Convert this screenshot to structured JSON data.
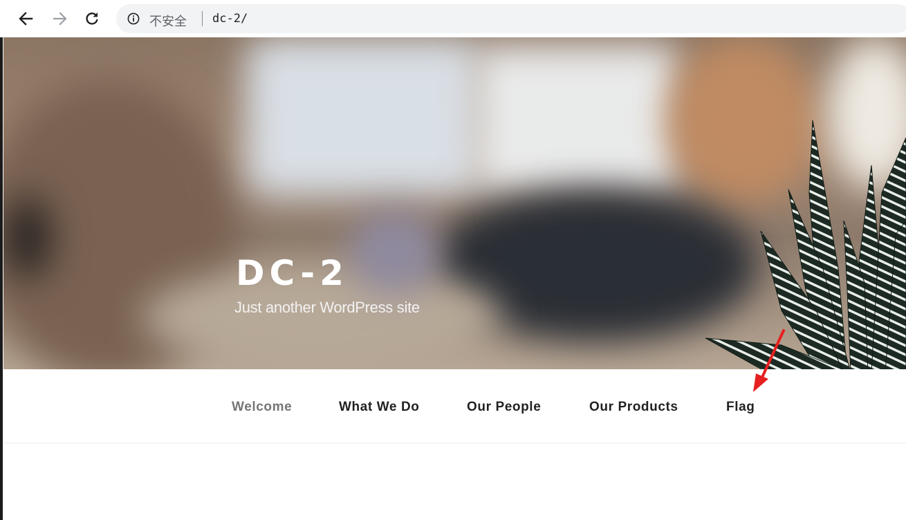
{
  "browser": {
    "security_label": "不安全",
    "url": "dc-2/",
    "accent_colors": {
      "toolbar_bg": "#ffffff",
      "omnibox_bg": "#f1f3f4",
      "icon": "#5f6368"
    }
  },
  "hero": {
    "site_title": "DC-2",
    "tagline": "Just another WordPress site"
  },
  "menu": {
    "items": [
      {
        "label": "Welcome",
        "current": true
      },
      {
        "label": "What We Do",
        "current": false
      },
      {
        "label": "Our People",
        "current": false
      },
      {
        "label": "Our Products",
        "current": false
      },
      {
        "label": "Flag",
        "current": false
      }
    ],
    "colors": {
      "current": "#767676",
      "default": "#222222"
    }
  },
  "annotation": {
    "arrow_color": "#e62020",
    "icon": "red-arrow-icon"
  }
}
